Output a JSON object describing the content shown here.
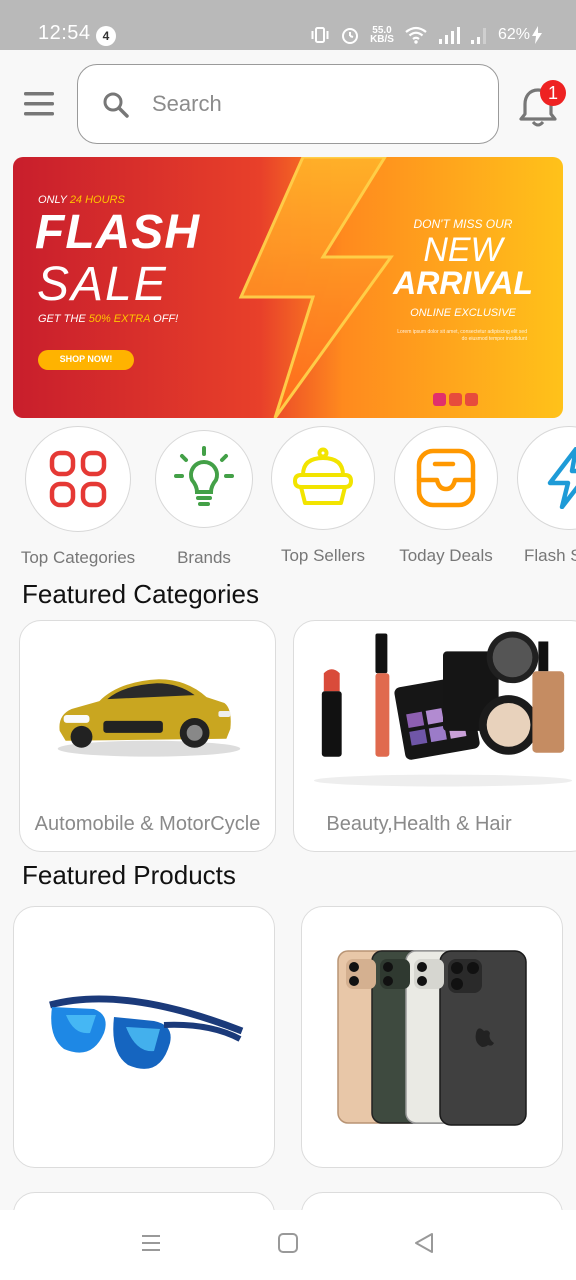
{
  "status_bar": {
    "time": "12:54",
    "notification_count": "4",
    "speed_value": "55.0",
    "speed_unit": "KB/S",
    "battery": "62%"
  },
  "header": {
    "search_placeholder": "Search",
    "notification_badge": "1"
  },
  "banner": {
    "tagline_prefix": "ONLY ",
    "tagline_highlight": "24 HOURS",
    "title_line1": "FLASH",
    "title_line2": "SALE",
    "offer_prefix": "GET THE ",
    "offer_highlight": "50% EXTRA",
    "offer_suffix": " OFF!",
    "cta": "SHOP NOW!",
    "right_kicker": "DON'T MISS OUR",
    "right_line1": "NEW",
    "right_line2": "ARRIVAL",
    "right_sub": "ONLINE EXCLUSIVE",
    "right_body": "Lorem ipsum dolor sit amet, consectetur adipiscing elit sed do eiusmod tempor incididunt"
  },
  "quick_categories": [
    {
      "label": "Top Categories",
      "icon": "grid-icon",
      "color": "#e53935"
    },
    {
      "label": "Brands",
      "icon": "lightbulb-icon",
      "color": "#43a047"
    },
    {
      "label": "Top Sellers",
      "icon": "cupcake-icon",
      "color": "#f2e400"
    },
    {
      "label": "Today Deals",
      "icon": "inbox-icon",
      "color": "#ff9800"
    },
    {
      "label": "Flash S",
      "icon": "lightning-icon",
      "color": "#1e9bd7"
    }
  ],
  "featured_categories": {
    "title": "Featured Categories",
    "items": [
      {
        "label": "Automobile & MotorCycle",
        "image": "yellow-car-image"
      },
      {
        "label": "Beauty,Health & Hair",
        "image": "cosmetics-image"
      }
    ]
  },
  "featured_products": {
    "title": "Featured Products",
    "items": [
      {
        "image": "blue-sunglasses-image"
      },
      {
        "image": "iphone-image"
      }
    ]
  },
  "colors": {
    "accent_red": "#ee2222",
    "banner_red": "#d8242b",
    "banner_yellow": "#ffc107"
  }
}
